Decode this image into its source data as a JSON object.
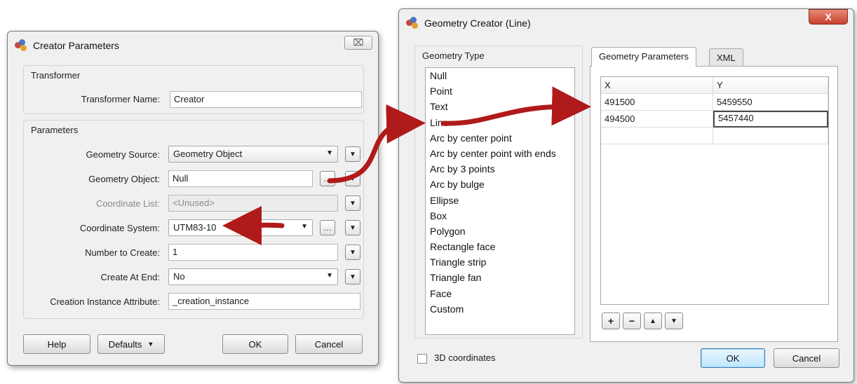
{
  "left_dialog": {
    "title": "Creator Parameters",
    "close_label": "⌧",
    "transformer_group": {
      "title": "Transformer",
      "name_label": "Transformer Name:",
      "name_value": "Creator"
    },
    "parameters_group": {
      "title": "Parameters",
      "geometry_source_label": "Geometry Source:",
      "geometry_source_value": "Geometry Object",
      "geometry_object_label": "Geometry Object:",
      "geometry_object_value": "Null",
      "coordinate_list_label": "Coordinate List:",
      "coordinate_list_value": "<Unused>",
      "coordinate_system_label": "Coordinate System:",
      "coordinate_system_value": "UTM83-10",
      "number_to_create_label": "Number to Create:",
      "number_to_create_value": "1",
      "create_at_end_label": "Create At End:",
      "create_at_end_value": "No",
      "creation_instance_label": "Creation Instance Attribute:",
      "creation_instance_value": "_creation_instance"
    },
    "buttons": {
      "help": "Help",
      "defaults": "Defaults",
      "ok": "OK",
      "cancel": "Cancel"
    }
  },
  "right_dialog": {
    "title": "Geometry Creator (Line)",
    "close_label": "X",
    "geometry_type_title": "Geometry Type",
    "geometry_types": [
      "Null",
      "Point",
      "Text",
      "Line",
      "Arc by center point",
      "Arc by center point with ends",
      "Arc by 3 points",
      "Arc by bulge",
      "Ellipse",
      "Box",
      "Polygon",
      "Rectangle face",
      "Triangle strip",
      "Triangle fan",
      "Face",
      "Custom"
    ],
    "selected_type": "Line",
    "tabs": [
      "Geometry Parameters",
      "XML"
    ],
    "grid": {
      "columns": [
        "X",
        "Y"
      ],
      "rows": [
        [
          "491500",
          "5459550"
        ],
        [
          "494500",
          "5457440"
        ]
      ]
    },
    "row_buttons": [
      "+",
      "−",
      "▲",
      "▼"
    ],
    "checkbox_3d_label": "3D coordinates",
    "ok": "OK",
    "cancel": "Cancel"
  },
  "colors": {
    "arrow": "#b01a1a",
    "window_bg": "#f0f0f0",
    "close_red": "#c7402c"
  }
}
